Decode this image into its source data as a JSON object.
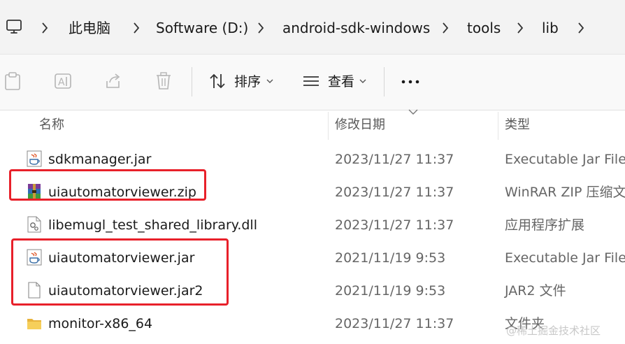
{
  "breadcrumb": {
    "items": [
      "此电脑",
      "Software (D:)",
      "android-sdk-windows",
      "tools",
      "lib"
    ]
  },
  "toolbar": {
    "sort_label": "排序",
    "view_label": "查看",
    "icons": [
      "paste-icon",
      "rename-icon",
      "share-icon",
      "delete-icon",
      "sort-icon",
      "view-icon",
      "more-icon"
    ]
  },
  "columns": {
    "name": "名称",
    "date": "修改日期",
    "type": "类型"
  },
  "files": [
    {
      "name": "sdkmanager.jar",
      "date": "2023/11/27 11:37",
      "type": "Executable Jar File",
      "icon": "java-jar-icon"
    },
    {
      "name": "uiautomatorviewer.zip",
      "date": "2023/11/27 11:37",
      "type": "WinRAR ZIP 压缩文件",
      "icon": "winrar-zip-icon"
    },
    {
      "name": "libemugl_test_shared_library.dll",
      "date": "2023/11/27 11:37",
      "type": "应用程序扩展",
      "icon": "dll-file-icon"
    },
    {
      "name": "uiautomatorviewer.jar",
      "date": "2021/11/19 9:53",
      "type": "Executable Jar File",
      "icon": "java-jar-icon"
    },
    {
      "name": "uiautomatorviewer.jar2",
      "date": "2021/11/19 9:53",
      "type": "JAR2 文件",
      "icon": "blank-file-icon"
    },
    {
      "name": "monitor-x86_64",
      "date": "2023/11/27 11:37",
      "type": "文件夹",
      "icon": "folder-icon"
    }
  ],
  "watermark": "@稀土掘金技术社区",
  "colors": {
    "highlight": "#e8202a",
    "folder": "#f2c94c",
    "toolbar_bg": "#f9f9f9",
    "addressbar_bg": "#f3f3f3"
  }
}
